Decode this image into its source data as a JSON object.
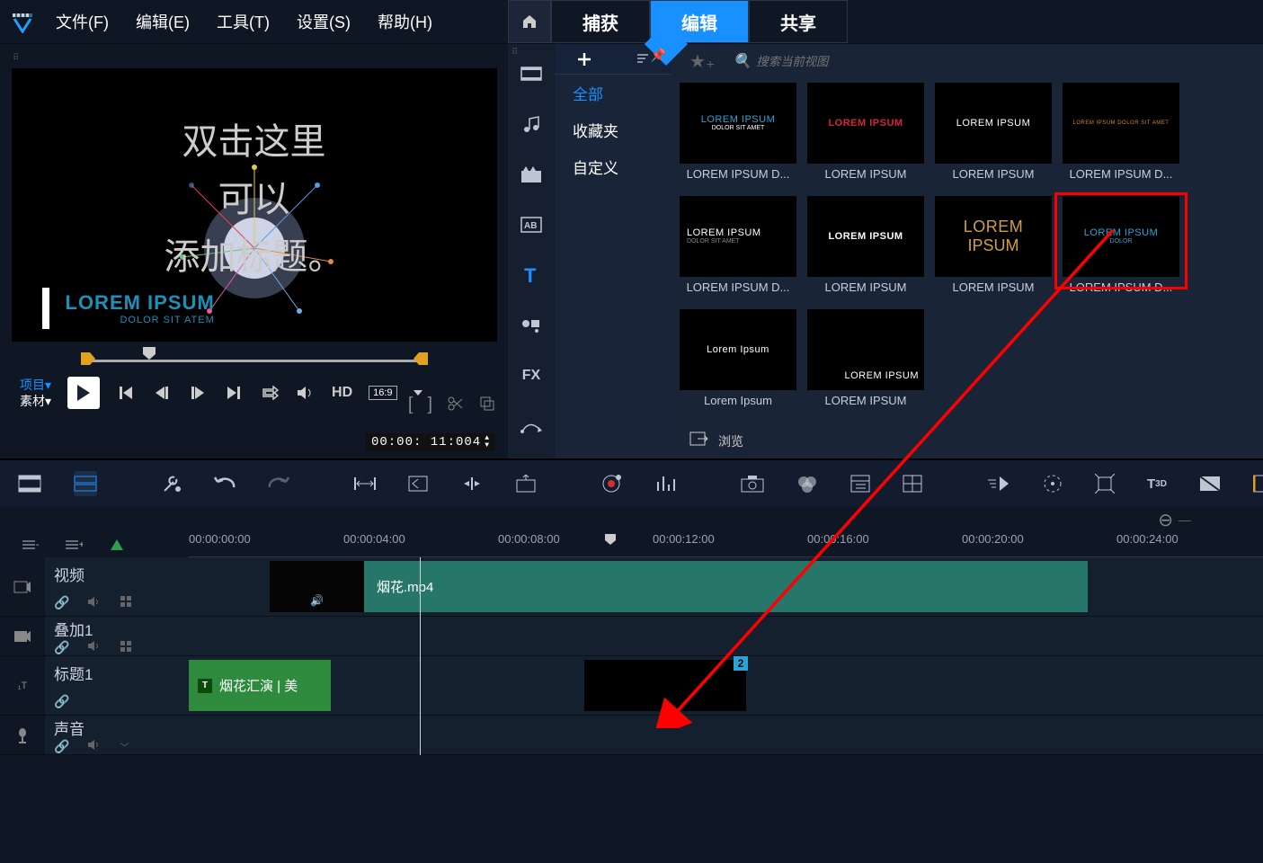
{
  "menubar": {
    "file": "文件(F)",
    "edit": "编辑(E)",
    "tools": "工具(T)",
    "settings": "设置(S)",
    "help": "帮助(H)"
  },
  "top_tabs": {
    "capture": "捕获",
    "edit": "编辑",
    "share": "共享",
    "active": "edit"
  },
  "preview": {
    "overlay_l1": "双击这里",
    "overlay_l2": "可以",
    "overlay_l3": "添加标题。",
    "title_t1": "LOREM IPSUM",
    "title_t2": "DOLOR SIT ATEM",
    "mode_project": "项目",
    "mode_clip": "素材",
    "hd_label": "HD",
    "aspect": "16:9",
    "timecode": "00:00: 11:004"
  },
  "library": {
    "side_icons": [
      "media",
      "audio",
      "effects",
      "transitions",
      "titles",
      "graphics",
      "fx-text",
      "paths"
    ],
    "active_side": 4,
    "categories": {
      "all": "全部",
      "favorites": "收藏夹",
      "custom": "自定义",
      "active": "all"
    },
    "search_placeholder": "搜索当前视图",
    "browse": "浏览",
    "items": [
      {
        "preview_l1": "LOREM IPSUM",
        "preview_l2": "DOLOR SIT AMET",
        "color1": "#2aa3d8",
        "color2": "#ffffff",
        "label": "LOREM IPSUM D..."
      },
      {
        "preview_l1": "LOREM  IPSUM",
        "preview_l2": "",
        "color1": "#d02838",
        "color2": "",
        "label": "LOREM  IPSUM"
      },
      {
        "preview_l1": "LOREM IPSUM",
        "preview_l2": "",
        "color1": "#ffffff",
        "color2": "",
        "label": "LOREM IPSUM"
      },
      {
        "preview_l1": "LOREM IPSUM DOLOR SIT AMET",
        "preview_l2": "",
        "color1": "#d08820",
        "color2": "",
        "label": "LOREM IPSUM D..."
      },
      {
        "preview_l1": "LOREM IPSUM",
        "preview_l2": "DOLOR SIT AMET",
        "color1": "#ffffff",
        "color2": "#888888",
        "label": "LOREM IPSUM D..."
      },
      {
        "preview_l1": "LOREM IPSUM",
        "preview_l2": "",
        "color1": "#ffffff",
        "color2": "",
        "label": "LOREM IPSUM"
      },
      {
        "preview_l1": "LOREM",
        "preview_l2": "IPSUM",
        "color1": "#d0a040",
        "color2": "#d0a040",
        "label": "LOREM IPSUM"
      },
      {
        "preview_l1": "LOREM IPSUM",
        "preview_l2": "DOLOR",
        "color1": "#2aa3d8",
        "color2": "#2aa3d8",
        "label": "LOREM IPSUM D...",
        "highlighted": true
      },
      {
        "preview_l1": "Lorem Ipsum",
        "preview_l2": "",
        "color1": "#ffffff",
        "color2": "",
        "label": "Lorem Ipsum"
      },
      {
        "preview_l1": "LOREM IPSUM",
        "preview_l2": "",
        "color1": "#ffffff",
        "color2": "",
        "label": "LOREM IPSUM"
      }
    ]
  },
  "timeline": {
    "ruler_ticks": [
      "00:00:00:00",
      "00:00:04:00",
      "00:00:08:00",
      "00:00:12:00",
      "00:00:16:00",
      "00:00:20:00",
      "00:00:24:00"
    ],
    "tracks": {
      "video": {
        "name": "视频",
        "clip_name": "烟花.mp4"
      },
      "overlay": {
        "name": "叠加1"
      },
      "title": {
        "name": "标题1",
        "clip1_name": "烟花汇演 | 美",
        "clip2_badge": "2"
      },
      "audio": {
        "name": "声音"
      }
    }
  }
}
